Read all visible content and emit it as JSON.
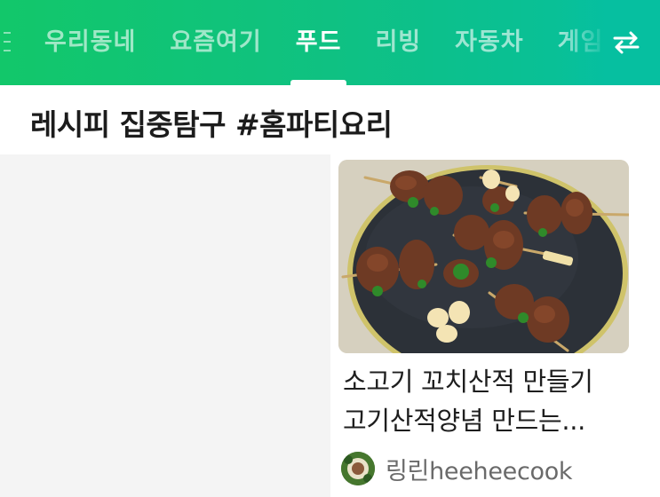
{
  "tabs": [
    {
      "label": "우리동네",
      "active": false
    },
    {
      "label": "요즘여기",
      "active": false
    },
    {
      "label": "푸드",
      "active": true
    },
    {
      "label": "리빙",
      "active": false
    },
    {
      "label": "자동차",
      "active": false
    },
    {
      "label": "게임",
      "active": false
    }
  ],
  "icons": {
    "swap": "swap-arrows-icon"
  },
  "colors": {
    "header_start": "#12c76a",
    "header_end": "#06bfa0",
    "accent": "#ffffff"
  },
  "section": {
    "title": "레시피 집중탐구 #홈파티요리"
  },
  "card": {
    "title_line1": "소고기 꼬치산적 만들기",
    "title_line2": "고기산적양념 만드는...",
    "author": "링린heeheecook"
  }
}
